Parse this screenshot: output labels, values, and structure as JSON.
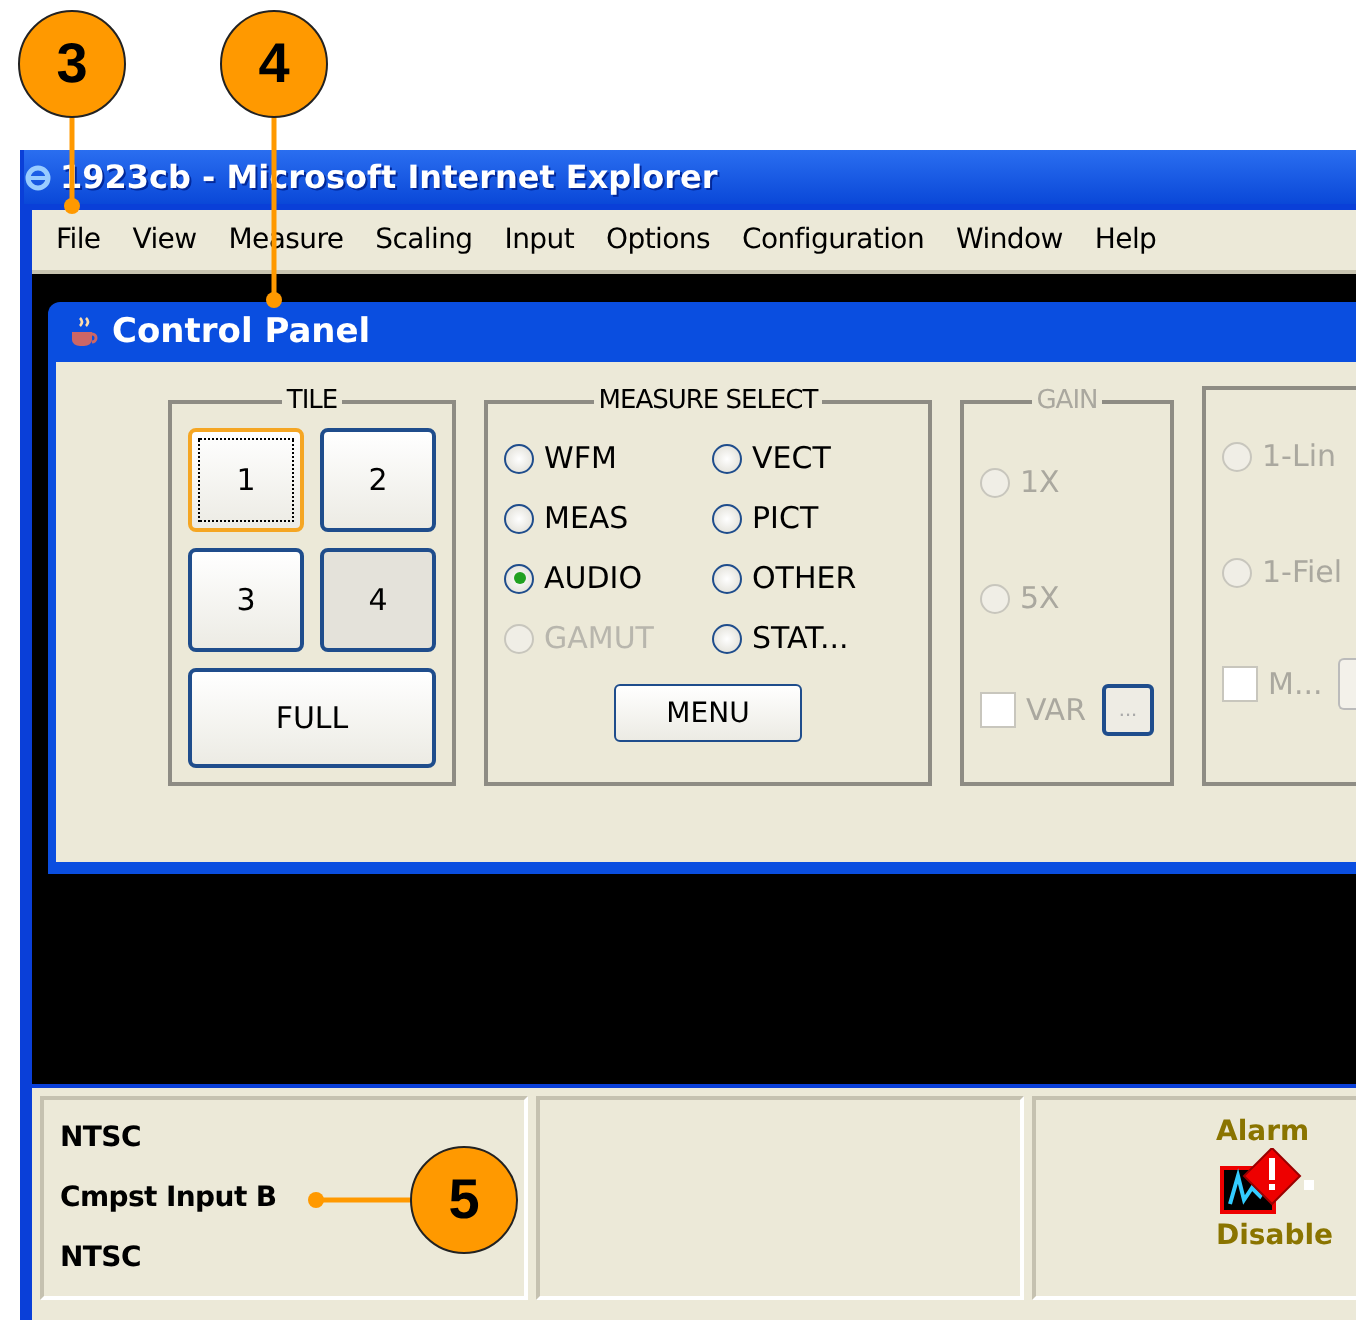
{
  "callouts": [
    {
      "number": "3"
    },
    {
      "number": "4"
    },
    {
      "number": "5"
    }
  ],
  "window": {
    "title": "1923cb - Microsoft Internet Explorer",
    "menu": [
      {
        "label": "File"
      },
      {
        "label": "View"
      },
      {
        "label": "Measure"
      },
      {
        "label": "Scaling"
      },
      {
        "label": "Input"
      },
      {
        "label": "Options"
      },
      {
        "label": "Configuration"
      },
      {
        "label": "Window"
      },
      {
        "label": "Help"
      }
    ]
  },
  "control_panel": {
    "title": "Control Panel",
    "tile": {
      "title": "TILE",
      "buttons": [
        {
          "label": "1",
          "focused": true,
          "pressed": false
        },
        {
          "label": "2",
          "focused": false,
          "pressed": false
        },
        {
          "label": "3",
          "focused": false,
          "pressed": false
        },
        {
          "label": "4",
          "focused": false,
          "pressed": true
        }
      ],
      "full_button": "FULL"
    },
    "measure_select": {
      "title": "MEASURE SELECT",
      "options": [
        {
          "label": "WFM",
          "selected": false,
          "disabled": false
        },
        {
          "label": "VECT",
          "selected": false,
          "disabled": false
        },
        {
          "label": "MEAS",
          "selected": false,
          "disabled": false
        },
        {
          "label": "PICT",
          "selected": false,
          "disabled": false
        },
        {
          "label": "AUDIO",
          "selected": true,
          "disabled": false
        },
        {
          "label": "OTHER",
          "selected": false,
          "disabled": false
        },
        {
          "label": "GAMUT",
          "selected": false,
          "disabled": true
        },
        {
          "label": "STAT...",
          "selected": false,
          "disabled": false
        }
      ],
      "menu_button": "MENU"
    },
    "gain": {
      "title": "GAIN",
      "disabled": true,
      "options": [
        {
          "label": "1X",
          "selected": false
        },
        {
          "label": "5X",
          "selected": false
        }
      ],
      "checkbox": {
        "label": "VAR",
        "checked": false
      },
      "more_button": "..."
    },
    "group_4": {
      "disabled": true,
      "options": [
        {
          "label": "1-Lin",
          "selected": false
        },
        {
          "label": "1-Fiel",
          "selected": false
        }
      ],
      "checkbox": {
        "label": "M...",
        "checked": false
      }
    }
  },
  "status_bar": {
    "pane_1": [
      "NTSC",
      "Cmpst Input B",
      "NTSC"
    ],
    "pane_3": {
      "alarm_label": "Alarm",
      "alarm_state": "Disable"
    }
  }
}
